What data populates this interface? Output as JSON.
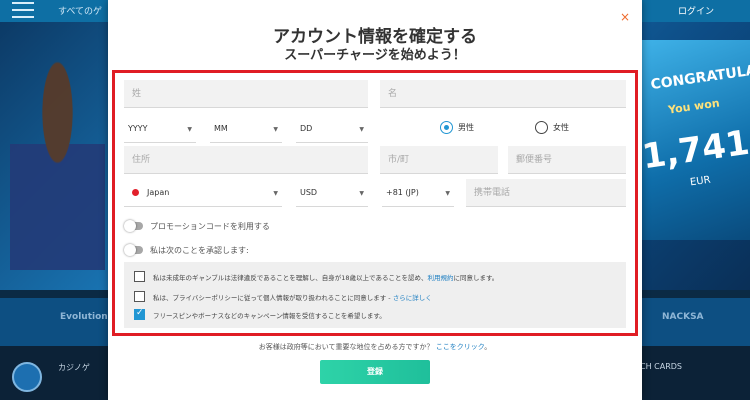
{
  "background": {
    "nav_text": "すべてのゲ",
    "login": "ログイン",
    "promo": {
      "headline": "CONGRATULATIONS!",
      "won": "You won",
      "amount": "1,741",
      "currency": "EUR"
    },
    "provider_logos": [
      "Evolution",
      "NACKSA"
    ],
    "bottom_left": "カジノゲ",
    "bottom_right": "CH CARDS"
  },
  "modal": {
    "title": "アカウント情報を確定する",
    "subtitle": "スーパーチャージを始めよう！",
    "close_icon": "×",
    "fields": {
      "first_name_placeholder": "姓",
      "last_name_placeholder": "名",
      "year": "YYYY",
      "month": "MM",
      "day": "DD",
      "gender_male": "男性",
      "gender_female": "女性",
      "selected_gender": "male",
      "address_placeholder": "住所",
      "city_placeholder": "市/町",
      "postcode_placeholder": "郵便番号",
      "country": "Japan",
      "currency": "USD",
      "phone_code": "+81 (JP)",
      "phone_placeholder": "携帯電話"
    },
    "toggles": {
      "promo_code": "プロモーションコードを利用する",
      "agree_following": "私は次のことを承認します:"
    },
    "consents": [
      {
        "text": "私は未成年のギャンブルは法律違反であることを理解し、自身が18歳以上であることを認め、",
        "link": "利用規約",
        "suffix": "に同意します。",
        "checked": false
      },
      {
        "text": "私は、プライバシーポリシーに従って個人情報が取り扱われることに同意します - ",
        "link": "さらに詳しく",
        "suffix": "",
        "checked": false
      },
      {
        "text": "フリースピンやボーナスなどのキャンペーン情報を受信することを希望します。",
        "link": "",
        "suffix": "",
        "checked": true
      }
    ],
    "pep_text": "お客様は政府等において重要な地位を占める方ですか？",
    "pep_link": "ここをクリック",
    "pep_suffix": "。",
    "register_button": "登録"
  },
  "colors": {
    "accent": "#2196d3",
    "close": "#ee6a2c",
    "highlight_border": "#e01d24",
    "register_button": "#2ed3a8"
  },
  "icons": {
    "dropdown": "chevron-down-icon",
    "close": "close-icon",
    "country_flag": "japan-flag-icon"
  }
}
